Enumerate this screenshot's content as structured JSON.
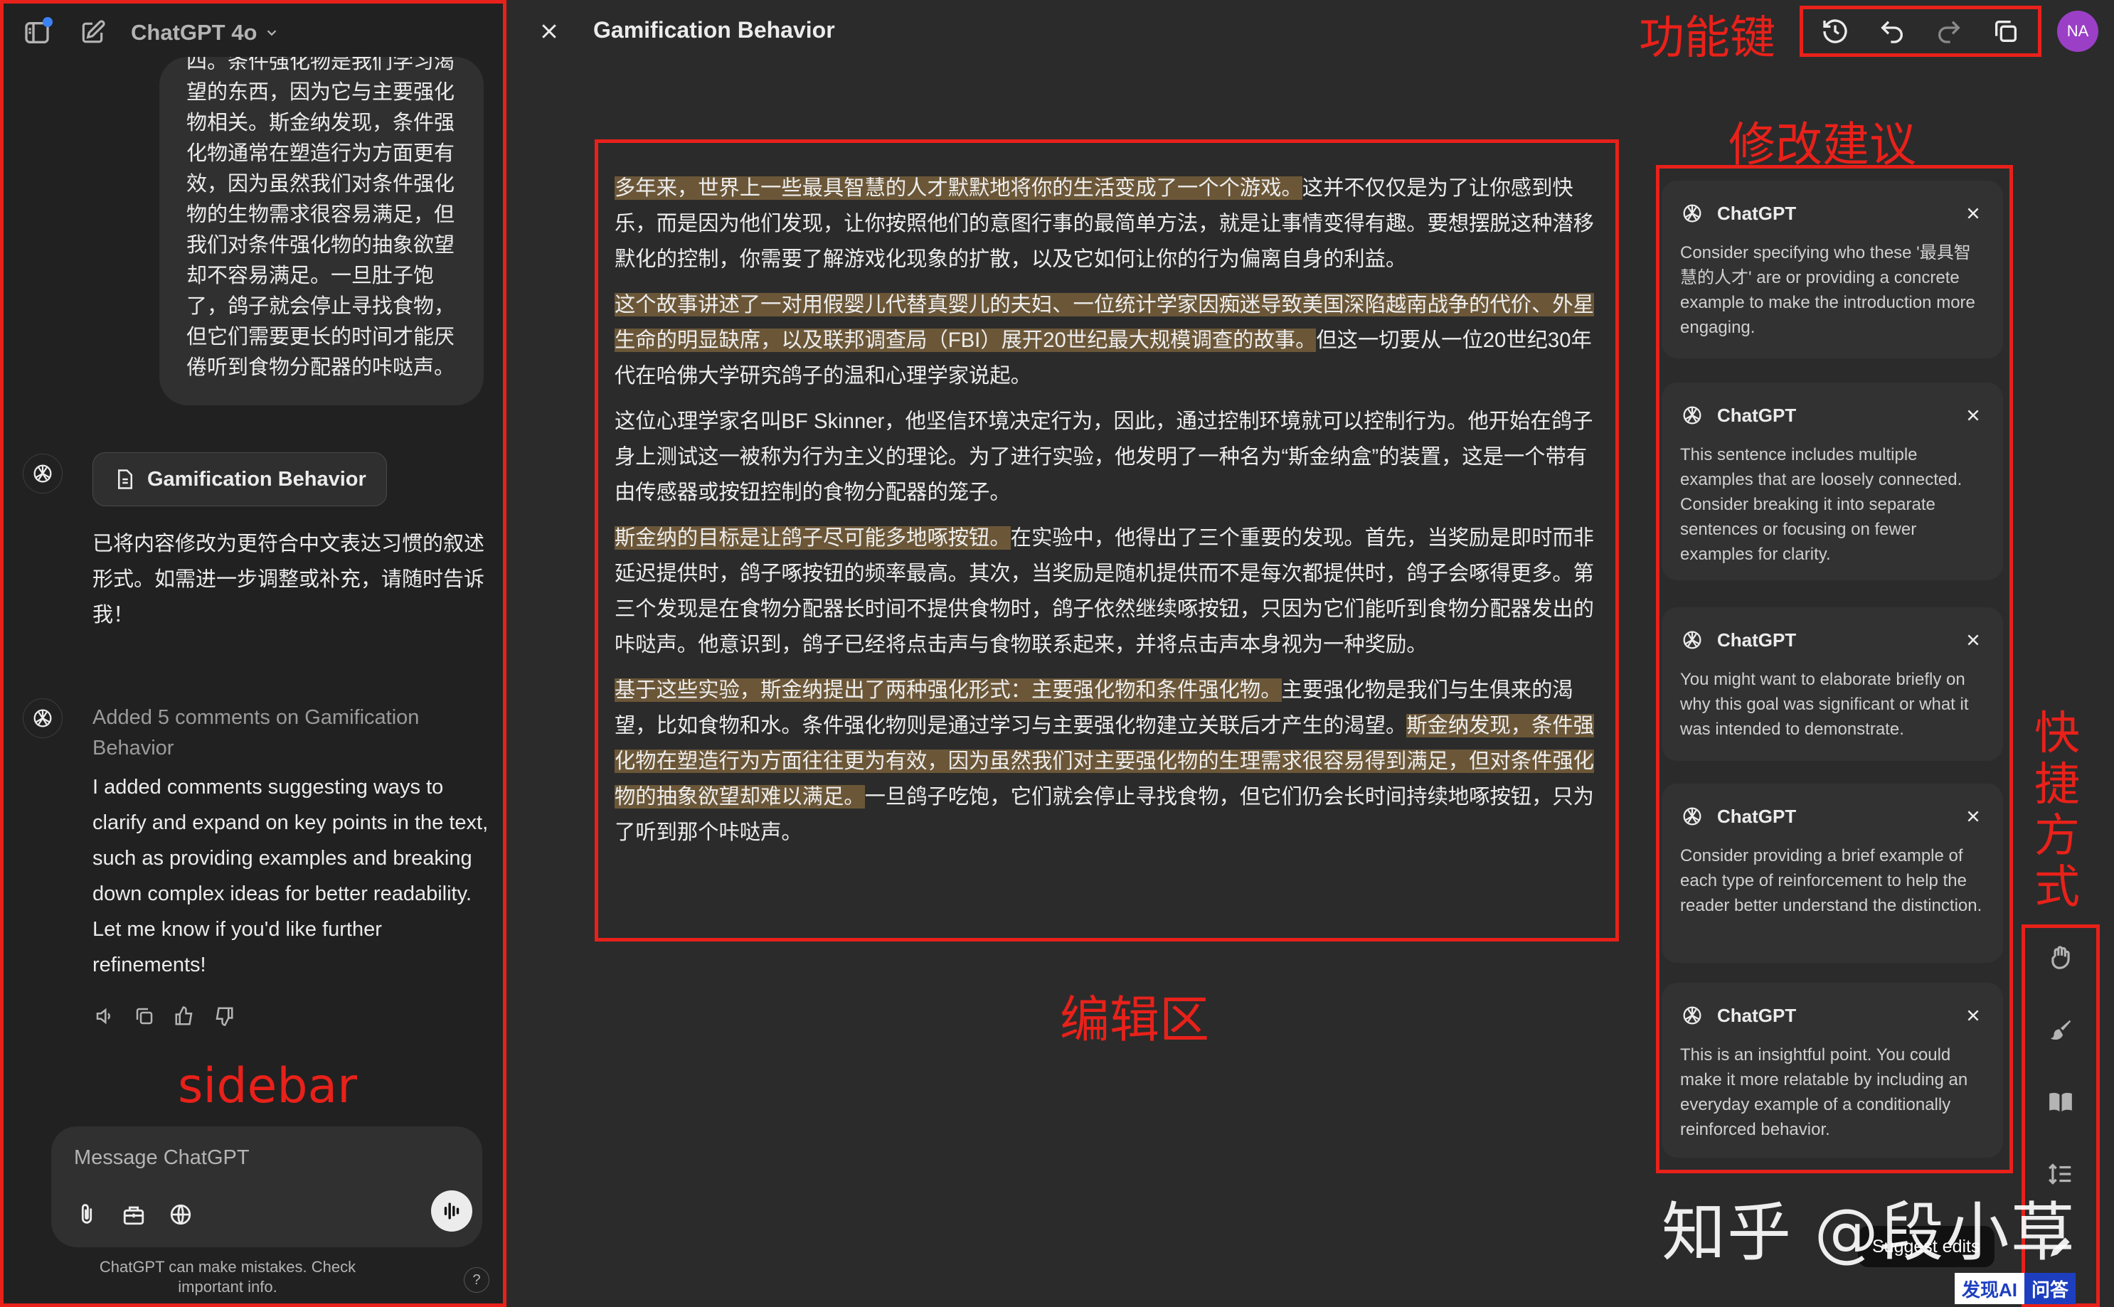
{
  "sidebar": {
    "model_name": "ChatGPT 4o",
    "user_message": "四。条件强化物是我们学习渴望的东西，因为它与主要强化物相关。斯金纳发现，条件强化物通常在塑造行为方面更有效，因为虽然我们对条件强化物的生物需求很容易满足，但我们对条件强化物的抽象欲望却不容易满足。一旦肚子饱了，鸽子就会停止寻找食物，但它们需要更长的时间才能厌倦听到食物分配器的咔哒声。",
    "doc_chip_label": "Gamification Behavior",
    "assistant_reply_1": "已将内容修改为更符合中文表达习惯的叙述形式。如需进一步调整或补充，请随时告诉我！",
    "added_comments_note": "Added 5 comments on Gamification Behavior",
    "assistant_reply_2": "I added comments suggesting ways to clarify and expand on key points in the text, such as providing examples and breaking down complex ideas for better readability. Let me know if you'd like further refinements!",
    "composer_placeholder": "Message ChatGPT",
    "disclaimer": "ChatGPT can make mistakes. Check important info.",
    "help_label": "?"
  },
  "canvas": {
    "title": "Gamification Behavior",
    "avatar_initials": "NA",
    "toolbar_icons": [
      "history-icon",
      "undo-icon",
      "redo-icon",
      "copy-icon"
    ]
  },
  "editor": {
    "paragraphs": [
      [
        {
          "text": "多年来，世界上一些最具智慧的人才默默地将你的生活变成了一个个游戏。",
          "hl": true
        },
        {
          "text": "这并不仅仅是为了让你感到快乐，而是因为他们发现，让你按照他们的意图行事的最简单方法，就是让事情变得有趣。要想摆脱这种潜移默化的控制，你需要了解游戏化现象的扩散，以及它如何让你的行为偏离自身的利益。",
          "hl": false
        }
      ],
      [
        {
          "text": "这个故事讲述了一对用假婴儿代替真婴儿的夫妇、一位统计学家因痴迷导致美国深陷越南战争的代价、外星生命的明显缺席，以及联邦调查局（FBI）展开20世纪最大规模调查的故事。",
          "hl": true
        },
        {
          "text": "但这一切要从一位20世纪30年代在哈佛大学研究鸽子的温和心理学家说起。",
          "hl": false
        }
      ],
      [
        {
          "text": "这位心理学家名叫BF Skinner，他坚信环境决定行为，因此，通过控制环境就可以控制行为。他开始在鸽子身上测试这一被称为行为主义的理论。为了进行实验，他发明了一种名为“斯金纳盒”的装置，这是一个带有由传感器或按钮控制的食物分配器的笼子。",
          "hl": false
        }
      ],
      [
        {
          "text": "斯金纳的目标是让鸽子尽可能多地啄按钮。",
          "hl": true
        },
        {
          "text": "在实验中，他得出了三个重要的发现。首先，当奖励是即时而非延迟提供时，鸽子啄按钮的频率最高。其次，当奖励是随机提供而不是每次都提供时，鸽子会啄得更多。第三个发现是在食物分配器长时间不提供食物时，鸽子依然继续啄按钮，只因为它们能听到食物分配器发出的咔哒声。他意识到，鸽子已经将点击声与食物联系起来，并将点击声本身视为一种奖励。",
          "hl": false
        }
      ],
      [
        {
          "text": "基于这些实验，斯金纳提出了两种强化形式：主要强化物和条件强化物。",
          "hl": true
        },
        {
          "text": "主要强化物是我们与生俱来的渴望，比如食物和水。条件强化物则是通过学习与主要强化物建立关联后才产生的渴望。",
          "hl": false
        },
        {
          "text": "斯金纳发现，条件强化物在塑造行为方面往往更为有效，因为虽然我们对主要强化物的生理需求很容易得到满足，但对条件强化物的抽象欲望却难以满足。",
          "hl": true
        },
        {
          "text": "一旦鸽子吃饱，它们就会停止寻找食物，但它们仍会长时间持续地啄按钮，只为了听到那个咔哒声。",
          "hl": false
        }
      ]
    ]
  },
  "comments": [
    {
      "author": "ChatGPT",
      "text": "Consider specifying who these '最具智慧的人才' are or providing a concrete example to make the introduction more engaging."
    },
    {
      "author": "ChatGPT",
      "text": "This sentence includes multiple examples that are loosely connected. Consider breaking it into separate sentences or focusing on fewer examples for clarity."
    },
    {
      "author": "ChatGPT",
      "text": "You might want to elaborate briefly on why this goal was significant or what it was intended to demonstrate."
    },
    {
      "author": "ChatGPT",
      "text": "Consider providing a brief example of each type of reinforcement to help the reader better understand the distinction."
    },
    {
      "author": "ChatGPT",
      "text": "This is an insightful point. You could make it more relatable by including an everyday example of a conditionally reinforced behavior."
    }
  ],
  "shortcuts": {
    "icons": [
      "emoji-icon",
      "polish-icon",
      "reading-level-icon",
      "length-icon",
      "suggest-edits-icon"
    ],
    "tooltip": "Suggest edits"
  },
  "annotations": {
    "functions": "功能键",
    "suggestions": "修改建议",
    "shortcuts": "快捷方式",
    "editor": "编辑区",
    "sidebar": "sidebar"
  },
  "watermark": "知乎 @段小草",
  "badge": {
    "left": "发现AI",
    "right": "问答"
  },
  "colors": {
    "annotation": "#e8211a",
    "highlight": "#6b5738",
    "avatar": "#9b3fc7"
  }
}
